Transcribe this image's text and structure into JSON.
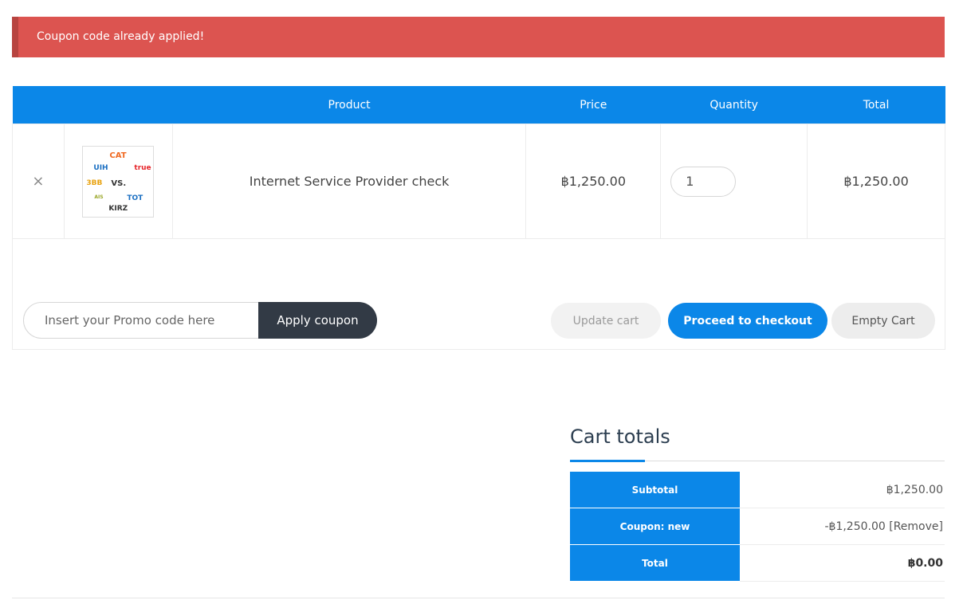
{
  "notice": {
    "message": "Coupon code already applied!"
  },
  "cart_table": {
    "headers": {
      "product": "Product",
      "price": "Price",
      "quantity": "Quantity",
      "total": "Total"
    },
    "rows": [
      {
        "remove_symbol": "×",
        "product_name": "Internet Service Provider check",
        "price": "฿1,250.00",
        "quantity": "1",
        "total": "฿1,250.00",
        "thumbnail_logos": {
          "a": "CAT",
          "b": "UIH",
          "c": "true",
          "d": "3BB",
          "e": "VS.",
          "f": "KIRZ",
          "g": "TOT",
          "h": "AIS"
        }
      }
    ]
  },
  "coupon": {
    "placeholder": "Insert your Promo code here",
    "apply_label": "Apply coupon"
  },
  "buttons": {
    "update_cart": "Update cart",
    "proceed_checkout": "Proceed to checkout",
    "empty_cart": "Empty Cart"
  },
  "cart_totals": {
    "title": "Cart totals",
    "rows": [
      {
        "label": "Subtotal",
        "value": "฿1,250.00"
      },
      {
        "label": "Coupon: new",
        "value": "-฿1,250.00",
        "link": "[Remove]"
      },
      {
        "label": "Total",
        "value": "฿0.00"
      }
    ]
  },
  "colors": {
    "accent_blue": "#0b87e8",
    "notice_red": "#dc5450",
    "dark_button": "#323a45"
  }
}
